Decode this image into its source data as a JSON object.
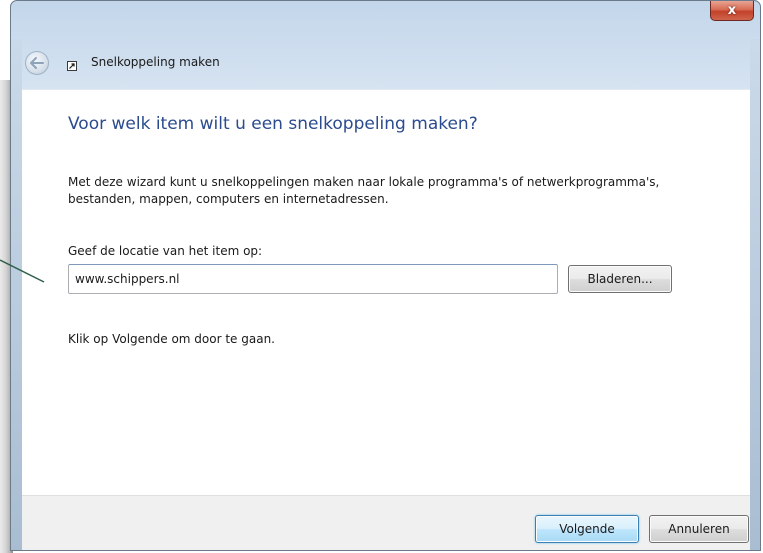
{
  "window": {
    "close_label": "x",
    "title": "Snelkoppeling maken"
  },
  "page": {
    "heading": "Voor welk item wilt u een snelkoppeling maken?",
    "description": "Met deze wizard kunt u snelkoppelingen maken naar lokale programma's of netwerkprogramma's, bestanden, mappen, computers en internetadressen.",
    "location_label": "Geef de locatie van het item op:",
    "location_value": "www.schippers.nl",
    "browse_label": "Bladeren...",
    "continue_text": "Klik op Volgende om door te gaan."
  },
  "footer": {
    "next_label": "Volgende",
    "cancel_label": "Annuleren"
  },
  "colors": {
    "heading": "#2b4b8f",
    "annotation_line": "#2f5f48",
    "close_button": "#c2422a"
  },
  "icons": [
    "back-arrow-icon",
    "shortcut-icon",
    "close-icon"
  ]
}
